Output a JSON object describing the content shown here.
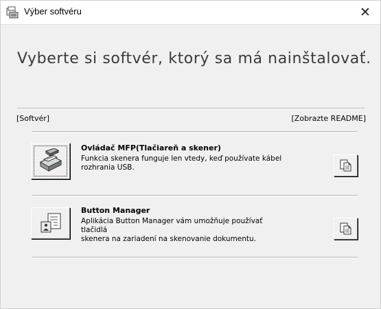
{
  "window": {
    "title": "Výber softvéru",
    "close_glyph": "✕"
  },
  "main": {
    "heading": "Vyberte si softvér, ktorý sa má nainštalovať."
  },
  "columns": {
    "software_label": "[Softvér]",
    "readme_label": "[Zobrazte README]"
  },
  "software": [
    {
      "title": "Ovládač MFP(Tlačiareň a skener)",
      "description_line1": "Funkcia skenera funguje len vtedy, keď používate kábel",
      "description_line2": "rozhrania USB.",
      "icon": "printer-scanner-icon",
      "readme_icon": "document-copy-icon"
    },
    {
      "title": "Button Manager",
      "description_line1": "Aplikácia Button Manager vám umožňuje používať tlačidlá",
      "description_line2": "skenera na zariadení na skenovanie dokumentu.",
      "icon": "button-manager-icon",
      "readme_icon": "document-copy-icon"
    }
  ]
}
